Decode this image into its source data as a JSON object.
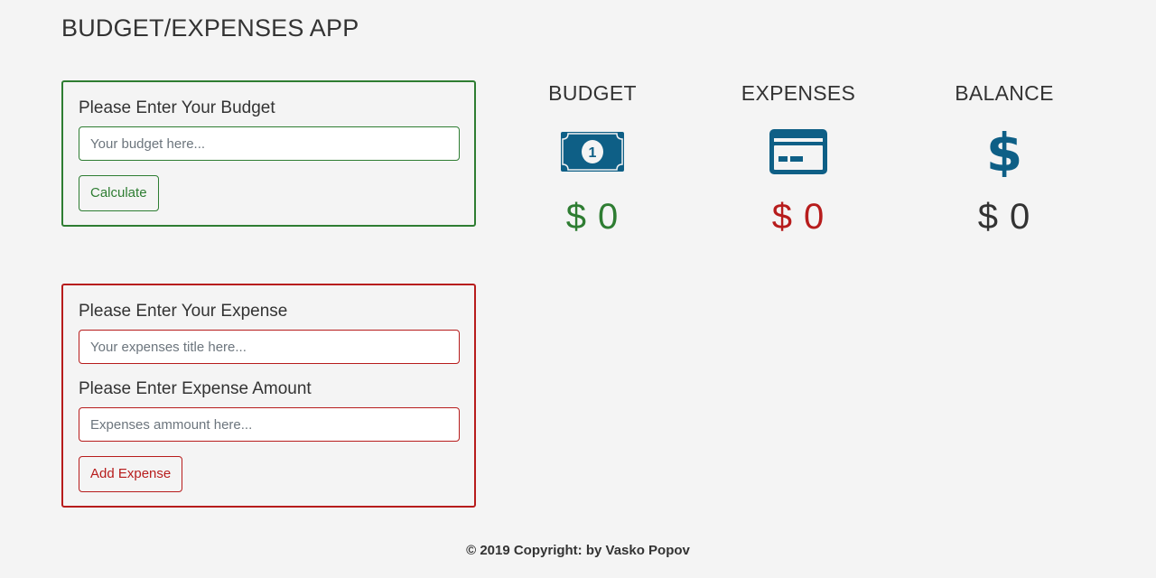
{
  "app": {
    "title": "BUDGET/EXPENSES APP"
  },
  "budget_form": {
    "label": "Please Enter Your Budget",
    "input_value": "",
    "input_placeholder": "Your budget here...",
    "button_label": "Calculate"
  },
  "expense_form": {
    "title_label": "Please Enter Your Expense",
    "title_value": "",
    "title_placeholder": "Your expenses title here...",
    "amount_label": "Please Enter Expense Amount",
    "amount_value": "",
    "amount_placeholder": "Expenses ammount here...",
    "button_label": "Add Expense"
  },
  "stats": {
    "budget": {
      "title": "BUDGET",
      "value": "$ 0",
      "icon": "money-bill-icon"
    },
    "expenses": {
      "title": "EXPENSES",
      "value": "$ 0",
      "icon": "credit-card-icon"
    },
    "balance": {
      "title": "BALANCE",
      "value": "$ 0",
      "icon": "dollar-sign-icon"
    }
  },
  "colors": {
    "success": "#2e7d32",
    "danger": "#b71c1c",
    "icon": "#0e5f86",
    "text": "#333333",
    "background": "#f4f4f4"
  },
  "footer": {
    "text": "© 2019 Copyright: by Vasko Popov"
  }
}
